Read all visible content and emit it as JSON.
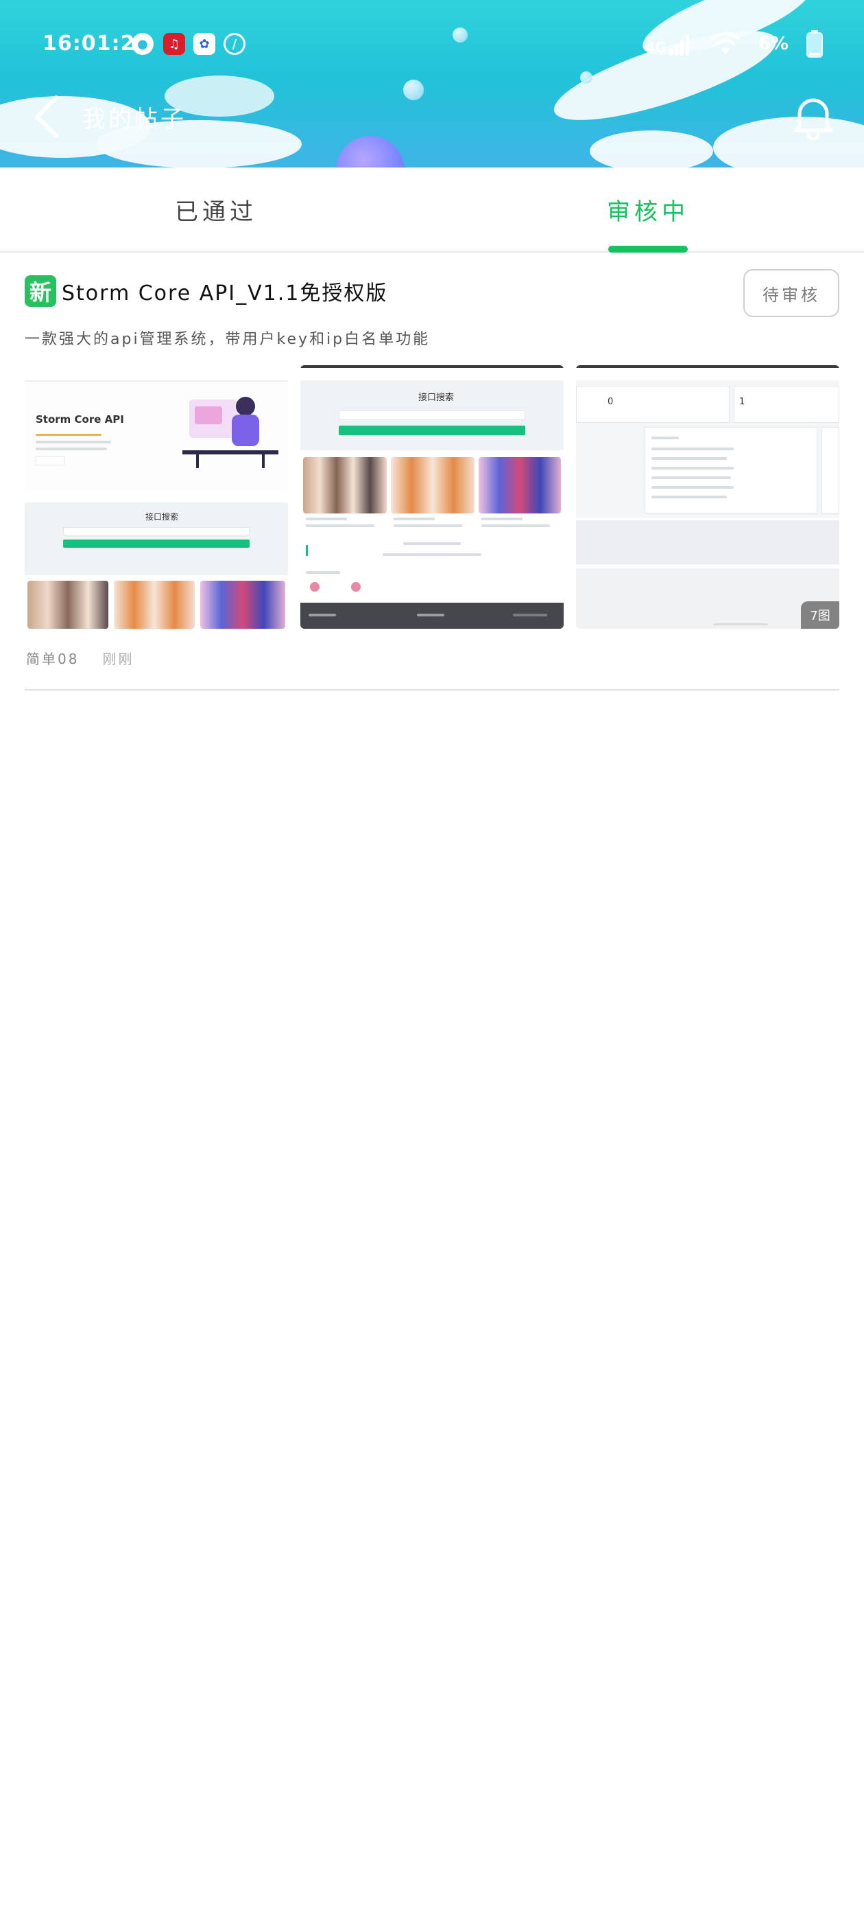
{
  "status_bar": {
    "time": "16:01:21",
    "network": "4G",
    "battery": "6%"
  },
  "nav": {
    "title": "我的帖子"
  },
  "tabs": [
    {
      "label": "已通过",
      "active": false
    },
    {
      "label": "审核中",
      "active": true
    }
  ],
  "post": {
    "badge": "新",
    "title": "Storm Core API_V1.1免授权版",
    "status": "待审核",
    "description": "一款强大的api管理系统，带用户key和ip白名单功能",
    "image_count": "7图",
    "author": "简单08",
    "time": "刚刚",
    "thumbnails": [
      {
        "heading": "Storm Core API",
        "search": "接口搜索"
      },
      {
        "search": "接口搜索"
      },
      {
        "values": [
          "0",
          "1"
        ]
      }
    ]
  },
  "colors": {
    "accent": "#16c160",
    "badge_green": "#27c25f"
  }
}
